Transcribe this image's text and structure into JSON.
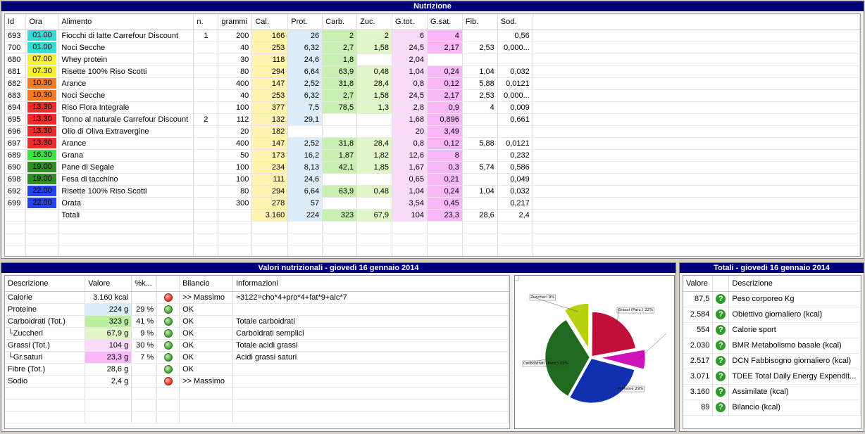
{
  "top": {
    "title": "Nutrizione",
    "headers": [
      "Id",
      "Ora",
      "Alimento",
      "n.",
      "grammi",
      "Cal.",
      "Prot.",
      "Carb.",
      "Zuc.",
      "G.tot.",
      "G.sat.",
      "Fib.",
      "Sod."
    ],
    "rows": [
      {
        "id": "693",
        "ora": "01.00",
        "ora_color": "#33dcd8",
        "alimento": "Fiocchi di latte Carrefour Discount",
        "n": "1",
        "grammi": "200",
        "cal": "166",
        "prot": "26",
        "carb": "2",
        "zuc": "2",
        "gtot": "6",
        "gsat": "4",
        "fib": "",
        "sod": "0,56"
      },
      {
        "id": "700",
        "ora": "01.00",
        "ora_color": "#33dcd8",
        "alimento": "Noci Secche",
        "n": "",
        "grammi": "40",
        "cal": "253",
        "prot": "6,32",
        "carb": "2,7",
        "zuc": "1,58",
        "gtot": "24,5",
        "gsat": "2,17",
        "fib": "2,53",
        "sod": "0,000..."
      },
      {
        "id": "680",
        "ora": "07.00",
        "ora_color": "#f6f030",
        "alimento": "Whey protein",
        "n": "",
        "grammi": "30",
        "cal": "118",
        "prot": "24,6",
        "carb": "1,8",
        "zuc": "",
        "gtot": "2,04",
        "gsat": "",
        "fib": "",
        "sod": ""
      },
      {
        "id": "681",
        "ora": "07.30",
        "ora_color": "#f6f030",
        "alimento": "Risette 100% Riso Scotti",
        "n": "",
        "grammi": "80",
        "cal": "294",
        "prot": "6,64",
        "carb": "63,9",
        "zuc": "0,48",
        "gtot": "1,04",
        "gsat": "0,24",
        "fib": "1,04",
        "sod": "0,032"
      },
      {
        "id": "682",
        "ora": "10.30",
        "ora_color": "#f57a22",
        "alimento": "Arance",
        "n": "",
        "grammi": "400",
        "cal": "147",
        "prot": "2,52",
        "carb": "31,8",
        "zuc": "28,4",
        "gtot": "0,8",
        "gsat": "0,12",
        "fib": "5,88",
        "sod": "0,0121"
      },
      {
        "id": "683",
        "ora": "10.30",
        "ora_color": "#f57a22",
        "alimento": "Noci Secche",
        "n": "",
        "grammi": "40",
        "cal": "253",
        "prot": "6,32",
        "carb": "2,7",
        "zuc": "1,58",
        "gtot": "24,5",
        "gsat": "2,17",
        "fib": "2,53",
        "sod": "0,000..."
      },
      {
        "id": "694",
        "ora": "13.30",
        "ora_color": "#ee2a2a",
        "alimento": "Riso Flora Integrale",
        "n": "",
        "grammi": "100",
        "cal": "377",
        "prot": "7,5",
        "carb": "78,5",
        "zuc": "1,3",
        "gtot": "2,8",
        "gsat": "0,9",
        "fib": "4",
        "sod": "0,009"
      },
      {
        "id": "695",
        "ora": "13.30",
        "ora_color": "#ee2a2a",
        "alimento": "Tonno al naturale Carrefour Discount",
        "n": "2",
        "grammi": "112",
        "cal": "132",
        "prot": "29,1",
        "carb": "",
        "zuc": "",
        "gtot": "1,68",
        "gsat": "0,896",
        "fib": "",
        "sod": "0,661"
      },
      {
        "id": "696",
        "ora": "13.30",
        "ora_color": "#ee2a2a",
        "alimento": "Olio di Oliva Extravergine",
        "n": "",
        "grammi": "20",
        "cal": "182",
        "prot": "",
        "carb": "",
        "zuc": "",
        "gtot": "20",
        "gsat": "3,49",
        "fib": "",
        "sod": ""
      },
      {
        "id": "697",
        "ora": "13.30",
        "ora_color": "#ee2a2a",
        "alimento": "Arance",
        "n": "",
        "grammi": "400",
        "cal": "147",
        "prot": "2,52",
        "carb": "31,8",
        "zuc": "28,4",
        "gtot": "0,8",
        "gsat": "0,12",
        "fib": "5,88",
        "sod": "0,0121"
      },
      {
        "id": "689",
        "ora": "16.30",
        "ora_color": "#3ee23e",
        "alimento": "Grana",
        "n": "",
        "grammi": "50",
        "cal": "173",
        "prot": "16,2",
        "carb": "1,87",
        "zuc": "1,82",
        "gtot": "12,6",
        "gsat": "8",
        "fib": "",
        "sod": "0,232"
      },
      {
        "id": "690",
        "ora": "19.00",
        "ora_color": "#2f8f22",
        "alimento": "Pane di Segale",
        "n": "",
        "grammi": "100",
        "cal": "234",
        "prot": "8,13",
        "carb": "42,1",
        "zuc": "1,85",
        "gtot": "1,67",
        "gsat": "0,3",
        "fib": "5,74",
        "sod": "0,586"
      },
      {
        "id": "698",
        "ora": "19.00",
        "ora_color": "#2f8f22",
        "alimento": "Fesa di tacchino",
        "n": "",
        "grammi": "100",
        "cal": "111",
        "prot": "24,6",
        "carb": "",
        "zuc": "",
        "gtot": "0,65",
        "gsat": "0,21",
        "fib": "",
        "sod": "0,049"
      },
      {
        "id": "692",
        "ora": "22.00",
        "ora_color": "#2442ee",
        "alimento": "Risette 100% Riso Scotti",
        "n": "",
        "grammi": "80",
        "cal": "294",
        "prot": "6,64",
        "carb": "63,9",
        "zuc": "0,48",
        "gtot": "1,04",
        "gsat": "0,24",
        "fib": "1,04",
        "sod": "0,032"
      },
      {
        "id": "699",
        "ora": "22.00",
        "ora_color": "#2442ee",
        "alimento": "Orata",
        "n": "",
        "grammi": "300",
        "cal": "278",
        "prot": "57",
        "carb": "",
        "zuc": "",
        "gtot": "3,54",
        "gsat": "0,45",
        "fib": "",
        "sod": "0,217"
      }
    ],
    "totals": {
      "label": "Totali",
      "cal": "3.160",
      "prot": "224",
      "carb": "323",
      "zuc": "67,9",
      "gtot": "104",
      "gsat": "23,3",
      "fib": "28,6",
      "sod": "2,4"
    }
  },
  "values": {
    "title": "Valori nutrizionali - giovedì 16 gennaio 2014",
    "headers": [
      "Descrizione",
      "Valore",
      "%k...",
      "",
      "Bilancio",
      "Informazioni"
    ],
    "rows": [
      {
        "desc": "Calorie",
        "valore": "3.160 kcal",
        "pct": "",
        "status": "red",
        "bilancio": ">> Massimo",
        "info": "≈3122=cho*4+pro*4+fat*9+alc*7",
        "bg": ""
      },
      {
        "desc": "Proteine",
        "valore": "224 g",
        "pct": "29 %",
        "status": "green",
        "bilancio": "OK",
        "info": "",
        "bg": "#dcecf8"
      },
      {
        "desc": "Carboidrati (Tot.)",
        "valore": "323 g",
        "pct": "41 %",
        "status": "green",
        "bilancio": "OK",
        "info": "Totale carboidrati",
        "bg": "#b8f0a0"
      },
      {
        "desc": "└Zuccheri",
        "valore": "67,9 g",
        "pct": "9 %",
        "status": "green",
        "bilancio": "OK",
        "info": "Carboidrati semplici",
        "bg": "#e2f7c8"
      },
      {
        "desc": "Grassi (Tot.)",
        "valore": "104 g",
        "pct": "30 %",
        "status": "green",
        "bilancio": "OK",
        "info": "Totale acidi grassi",
        "bg": "#fadcfa"
      },
      {
        "desc": "└Gr.saturi",
        "valore": "23,3 g",
        "pct": "7 %",
        "status": "green",
        "bilancio": "OK",
        "info": "Acidi grassi saturi",
        "bg": "#f8b8f8"
      },
      {
        "desc": "Fibre (Tot.)",
        "valore": "28,6 g",
        "pct": "",
        "status": "green",
        "bilancio": "OK",
        "info": "",
        "bg": ""
      },
      {
        "desc": "Sodio",
        "valore": "2,4 g",
        "pct": "",
        "status": "red",
        "bilancio": ">> Massimo",
        "info": "",
        "bg": ""
      }
    ]
  },
  "chart_data": {
    "type": "pie",
    "slices": [
      {
        "label": "Zuccheri 9%",
        "value": 9,
        "color": "#b8d010"
      },
      {
        "label": "Grassi (Parz.) 22%",
        "value": 22,
        "color": "#c0103a"
      },
      {
        "label": "",
        "value": 7,
        "color": "#d010b8"
      },
      {
        "label": "Proteine 29%",
        "value": 29,
        "color": "#1030b0"
      },
      {
        "label": "Carboidrati (Parz.) 33%",
        "value": 33,
        "color": "#1f6a1f"
      }
    ]
  },
  "totals_panel": {
    "title": "Totali - giovedì 16 gennaio 2014",
    "headers": [
      "Valore",
      "",
      "Descrizione"
    ],
    "rows": [
      {
        "valore": "87,5",
        "desc": "Peso corporeo Kg"
      },
      {
        "valore": "2.584",
        "desc": "Obiettivo giornaliero (kcal)"
      },
      {
        "valore": "554",
        "desc": "Calorie sport"
      },
      {
        "valore": "2.030",
        "desc": "BMR Metabolismo basale (kcal)"
      },
      {
        "valore": "2.517",
        "desc": "DCN Fabbisogno giornaliero (kcal)"
      },
      {
        "valore": "3.071",
        "desc": "TDEE Total Daily Energy Expendit..."
      },
      {
        "valore": "3.160",
        "desc": "Assimilate (kcal)"
      },
      {
        "valore": "89",
        "desc": "Bilancio (kcal)"
      }
    ]
  }
}
